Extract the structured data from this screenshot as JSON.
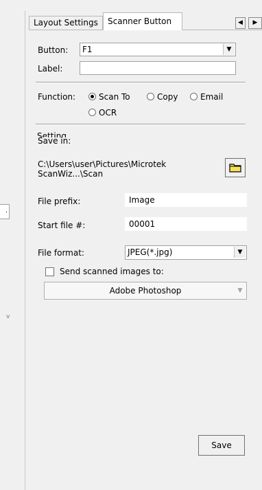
{
  "tabs": [
    {
      "label": "Layout Settings"
    },
    {
      "label": "Scanner Button"
    }
  ],
  "tab_scroll": {
    "left_icon": "left-arrow",
    "right_icon": "right-arrow"
  },
  "button_field": {
    "label": "Button:",
    "value": "F1"
  },
  "label_field": {
    "label": "Label:",
    "value": ""
  },
  "function": {
    "label": "Function:",
    "options": [
      {
        "label": "Scan To",
        "selected": true
      },
      {
        "label": "Copy",
        "selected": false
      },
      {
        "label": "Email",
        "selected": false
      },
      {
        "label": "OCR",
        "selected": false
      }
    ]
  },
  "setting": {
    "group_label": "Setting",
    "save_in_label": "Save in:",
    "save_path": "C:\\Users\\user\\Pictures\\Microtek ScanWiz...\\Scan",
    "save_path_line1": "C:\\Users\\user\\Pictures\\Microtek",
    "save_path_line2": "ScanWiz...\\Scan",
    "file_prefix_label": "File prefix:",
    "file_prefix_value": "Image",
    "start_file_label": "Start file #:",
    "start_file_value": "00001",
    "file_format_label": "File format:",
    "file_format_value": "JPEG(*.jpg)",
    "send_label": "Send scanned images to:",
    "send_checked": false,
    "send_app": "Adobe Photoshop"
  },
  "save_button": "Save"
}
